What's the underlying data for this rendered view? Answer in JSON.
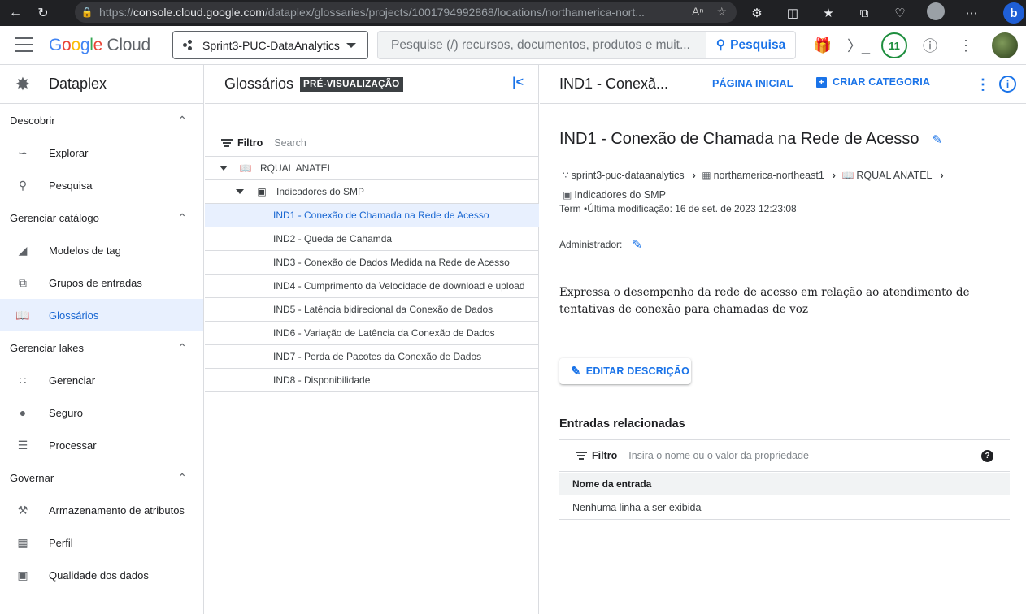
{
  "browser": {
    "url_prefix": "https://",
    "url_host": "console.cloud.google.com",
    "url_path": "/dataplex/glossaries/projects/1001794992868/locations/northamerica-nort..."
  },
  "header": {
    "logo_google": [
      "G",
      "o",
      "o",
      "g",
      "l",
      "e"
    ],
    "logo_cloud": "Cloud",
    "project": "Sprint3-PUC-DataAnalytics",
    "search_placeholder": "Pesquise (/) recursos, documentos, produtos e muit...",
    "search_button": "Pesquisa",
    "notifications_count": "11"
  },
  "nav": {
    "title": "Dataplex",
    "sections": [
      {
        "label": "Descobrir",
        "items": [
          {
            "label": "Explorar",
            "icon": "explore-icon"
          },
          {
            "label": "Pesquisa",
            "icon": "search-icon"
          }
        ]
      },
      {
        "label": "Gerenciar catálogo",
        "items": [
          {
            "label": "Modelos de tag",
            "icon": "tag-icon"
          },
          {
            "label": "Grupos de entradas",
            "icon": "entry-groups-icon"
          },
          {
            "label": "Glossários",
            "icon": "glossary-icon"
          }
        ]
      },
      {
        "label": "Gerenciar lakes",
        "items": [
          {
            "label": "Gerenciar",
            "icon": "grid-icon"
          },
          {
            "label": "Seguro",
            "icon": "person-icon"
          },
          {
            "label": "Processar",
            "icon": "list-icon"
          }
        ]
      },
      {
        "label": "Governar",
        "items": [
          {
            "label": "Armazenamento de atributos",
            "icon": "gavel-icon"
          },
          {
            "label": "Perfil",
            "icon": "profile-icon"
          },
          {
            "label": "Qualidade dos dados",
            "icon": "quality-icon"
          }
        ]
      }
    ]
  },
  "glossary": {
    "title": "Glossários",
    "badge": "PRÉ-VISUALIZAÇÃO",
    "filter_label": "Filtro",
    "filter_placeholder": "Search",
    "root": "RQUAL ANATEL",
    "category": "Indicadores do SMP",
    "terms": [
      "IND1 - Conexão de Chamada na Rede de Acesso",
      "IND2 - Queda de Cahamda",
      "IND3 - Conexão de Dados Medida na Rede de Acesso",
      "IND4 - Cumprimento da Velocidade de download e upload",
      "IND5 - Latência bidirecional da Conexão de Dados",
      "IND6 - Variação de Latência da Conexão de Dados",
      "IND7 - Perda de Pacotes da Conexão de Dados",
      "IND8 - Disponibilidade"
    ]
  },
  "detail": {
    "tab_title": "IND1 - Conexã...",
    "home": "PÁGINA INICIAL",
    "create_category": "CRIAR CATEGORIA",
    "title": "IND1 - Conexão de Chamada na Rede de Acesso",
    "breadcrumb": [
      "sprint3-puc-dataanalytics",
      "northamerica-northeast1",
      "RQUAL ANATEL",
      "Indicadores do SMP"
    ],
    "meta": "Term •Última modificação: 16 de set. de 2023 12:23:08",
    "admin_label": "Administrador:",
    "description": "Expressa o desempenho da rede de acesso em relação ao atendimento de tentativas de conexão para chamadas de voz",
    "edit_button": "EDITAR DESCRIÇÃO",
    "related_title": "Entradas relacionadas",
    "related_filter_label": "Filtro",
    "related_filter_placeholder": "Insira o nome ou o valor da propriedade",
    "column_name": "Nome da entrada",
    "empty_text": "Nenhuma linha a ser exibida"
  }
}
